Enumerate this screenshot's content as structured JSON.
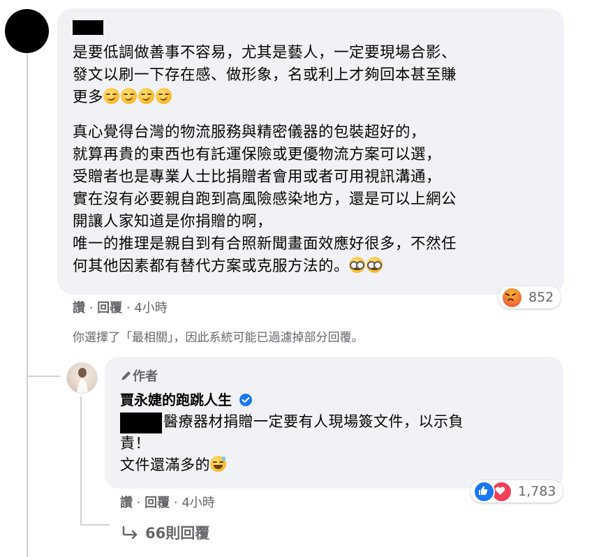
{
  "comment": {
    "paragraph1": [
      "是要低調做善事不容易，尤其是藝人，一定要現場合影、",
      "發文以刷一下存在感、做形象，名或利上才夠回本甚至賺",
      "更多"
    ],
    "paragraph2": [
      "真心覺得台灣的物流服務與精密儀器的包裝超好的，",
      "就算再貴的東西也有託運保險或更優物流方案可以選，",
      "受贈者也是專業人士比捐贈者會用或者可用視訊溝通，",
      "實在沒有必要親自跑到高風險感染地方，還是可以上網公",
      "開讓人家知道是你捐贈的啊，",
      "唯一的推理是親自到有合照新聞畫面效應好很多，不然任",
      "何其他因素都有替代方案或克服方法的。"
    ],
    "like_label": "讚",
    "reply_label": "回覆",
    "time": "4小時",
    "reaction_count": "852",
    "reaction_icon": "angry-reaction-icon"
  },
  "filter_notice": "你選擇了「最相關」，因此系統可能已過濾掉部分回覆。",
  "reply": {
    "author_badge": "作者",
    "author_name": "賈永婕的跑跳人生",
    "lines": [
      "醫療器材捐贈一定要有人現場簽文件，以示負",
      "責！",
      "文件還滿多的"
    ],
    "like_label": "讚",
    "reply_label": "回覆",
    "time": "4小時",
    "reaction_count": "1,783"
  },
  "more_replies": "66則回覆",
  "colors": {
    "bubble": "#f0f2f5",
    "meta": "#65676b",
    "verified": "#1877f2",
    "like": "#1877f2",
    "love": "#f33e58",
    "angry": "#f2723a"
  }
}
